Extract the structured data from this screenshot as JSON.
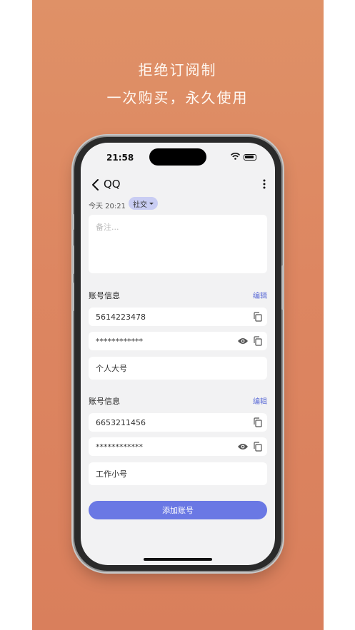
{
  "promo": {
    "line1": "拒绝订阅制",
    "line2": "一次购买，永久使用"
  },
  "status_bar": {
    "time": "21:58"
  },
  "header": {
    "title": "QQ"
  },
  "meta": {
    "time": "今天 20:21",
    "tag": "社交"
  },
  "notes": {
    "placeholder": "备注...",
    "value": ""
  },
  "accounts": [
    {
      "section_title": "账号信息",
      "edit_label": "编辑",
      "username": "5614223478",
      "password_masked": "************",
      "remark": "个人大号"
    },
    {
      "section_title": "账号信息",
      "edit_label": "编辑",
      "username": "6653211456",
      "password_masked": "************",
      "remark": "工作小号"
    }
  ],
  "add_button": "添加账号",
  "colors": {
    "accent": "#6a78e4",
    "edit_link": "#5a6ad6",
    "tag_bg": "#c9cdf3",
    "poster_bg": "#dd8661"
  }
}
